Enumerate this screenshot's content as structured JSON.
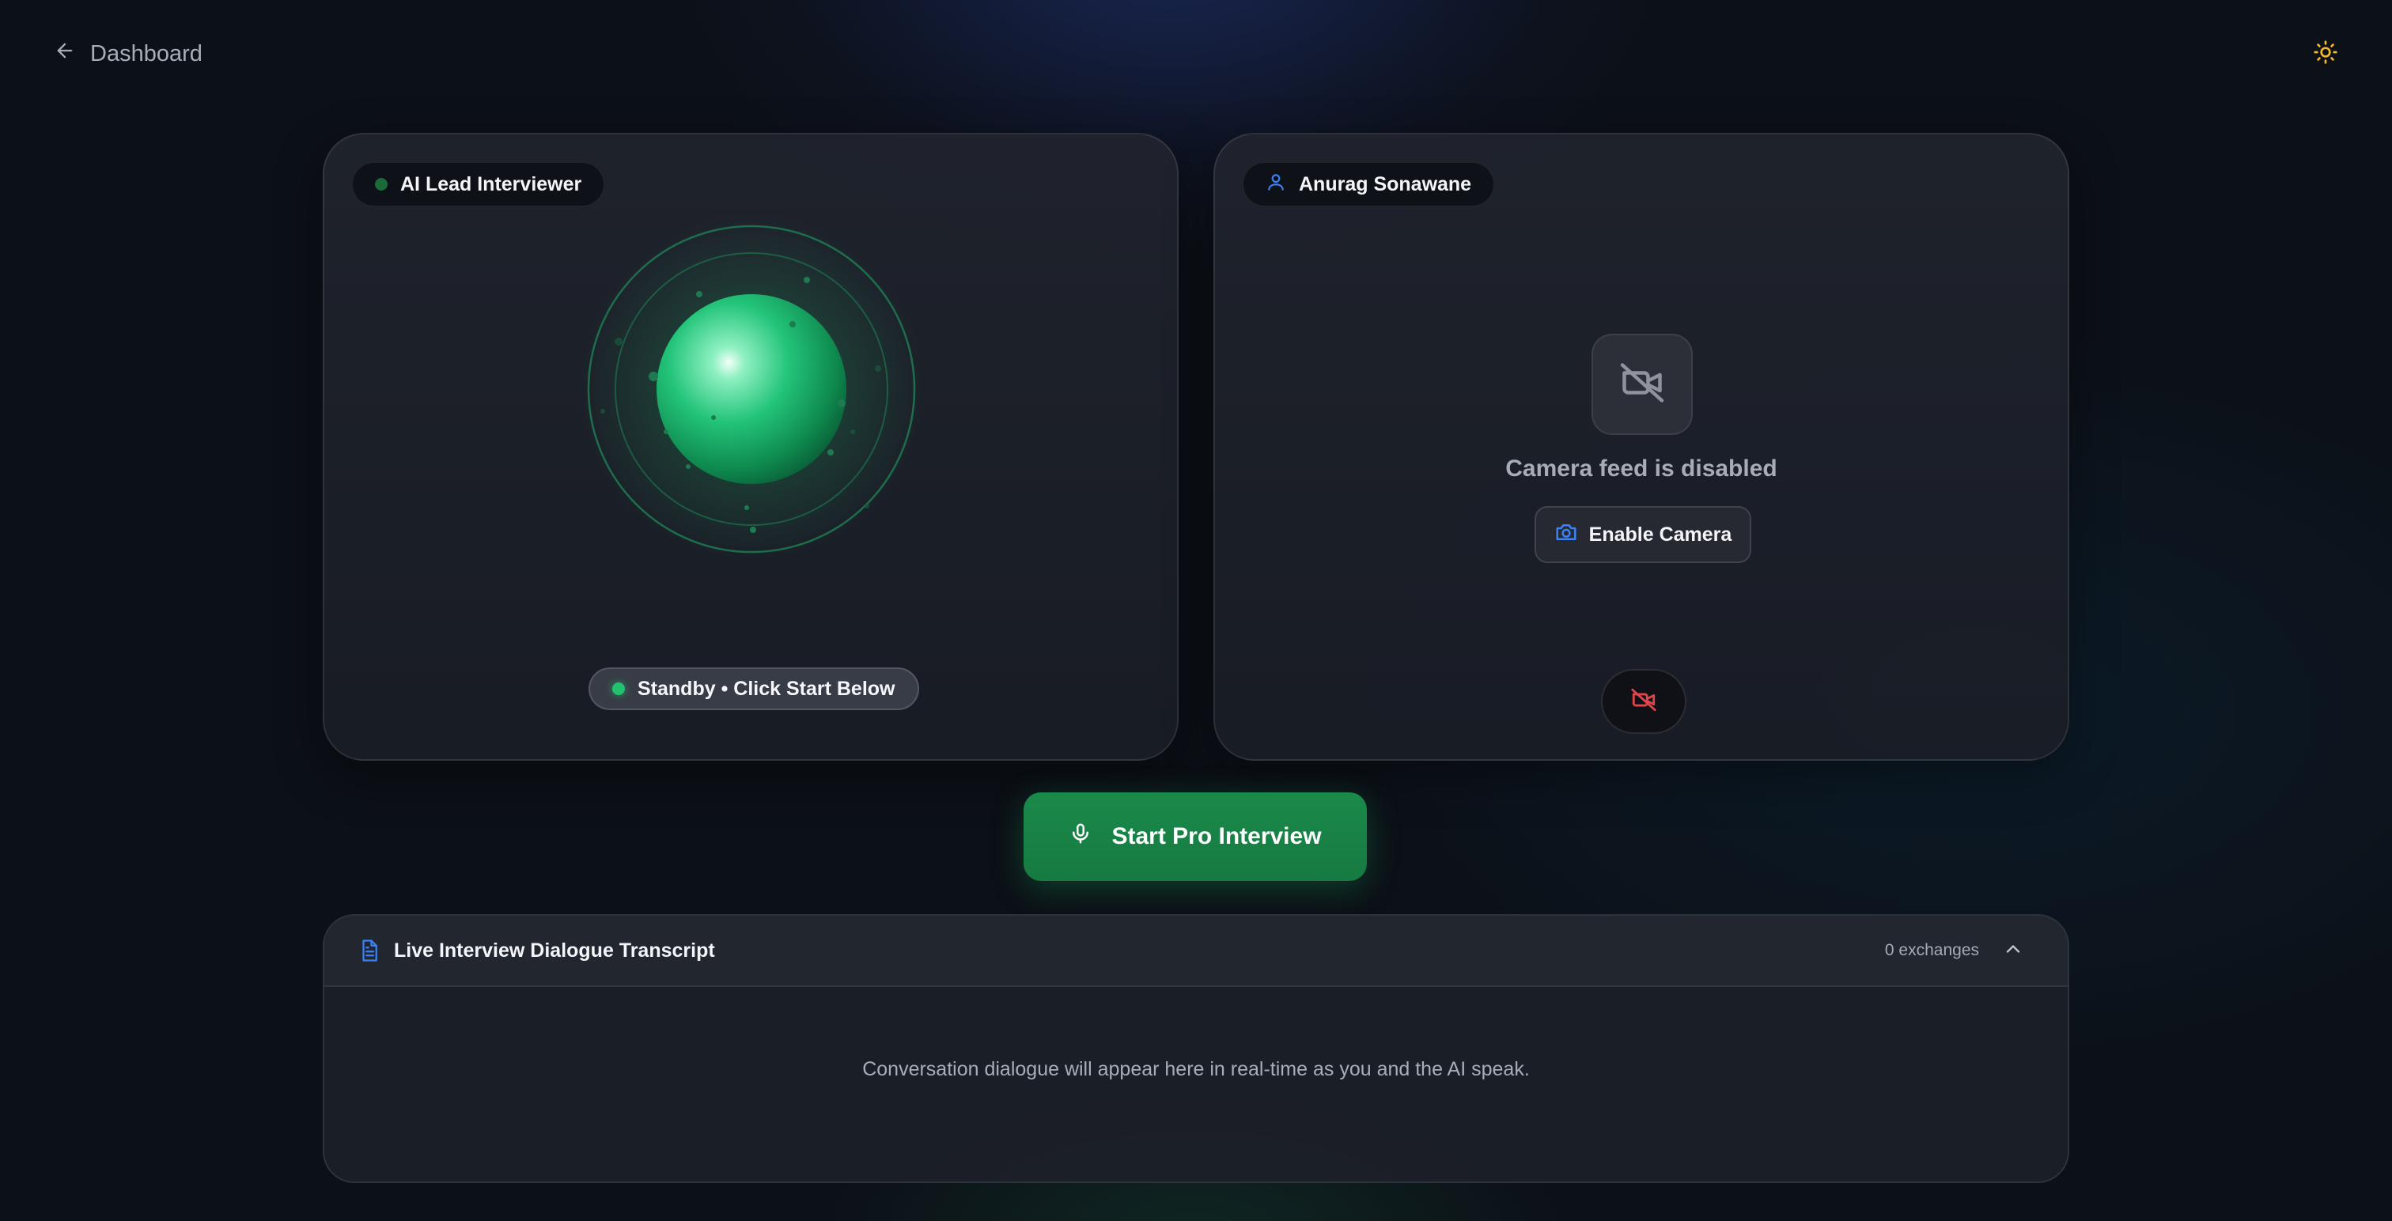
{
  "header": {
    "back_label": "Dashboard"
  },
  "ai_panel": {
    "badge_label": "AI Lead Interviewer",
    "status_label": "Standby • Click Start Below",
    "orb_color": "#22c270"
  },
  "user_panel": {
    "badge_label": "Anurag Sonawane",
    "camera_status": "Camera feed is disabled",
    "enable_camera_label": "Enable Camera"
  },
  "controls": {
    "start_label": "Start Pro Interview"
  },
  "transcript": {
    "title": "Live Interview Dialogue Transcript",
    "exchange_count": "0 exchanges",
    "empty_message": "Conversation dialogue will appear here in real-time as you and the AI speak."
  },
  "colors": {
    "accent_green": "#1a8a4a",
    "accent_blue": "#3b82f6",
    "danger_red": "#e0454a",
    "theme_icon": "#f5b82a"
  },
  "icons": {
    "back": "arrow-left-icon",
    "theme": "sun-icon",
    "user": "user-icon",
    "camera_off": "video-off-icon",
    "camera": "camera-icon",
    "mic": "mic-icon",
    "document": "file-text-icon",
    "collapse": "chevron-up-icon"
  }
}
